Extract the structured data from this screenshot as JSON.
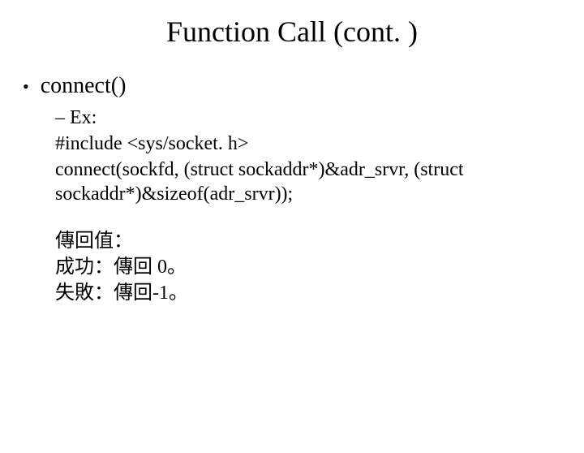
{
  "title": "Function Call (cont. )",
  "bullet": {
    "marker": "•",
    "text": "connect()"
  },
  "sub": {
    "dash_marker": "–",
    "ex_label": "Ex:",
    "include_line": "#include <sys/socket. h>",
    "call_line": "connect(sockfd, (struct sockaddr*)&adr_srvr, (struct sockaddr*)&sizeof(adr_srvr));",
    "ret_header": "傳回值：",
    "ret_success": "成功：傳回 0。",
    "ret_fail": "失敗：傳回-1。"
  }
}
